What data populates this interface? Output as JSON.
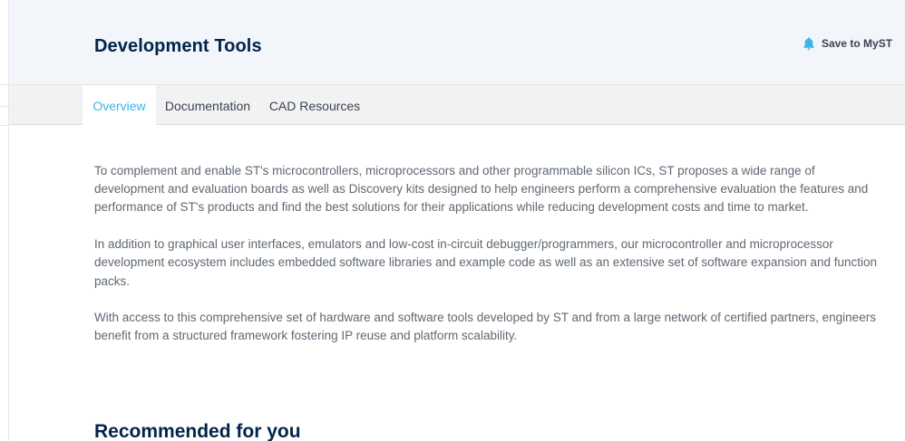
{
  "header": {
    "title": "Development Tools",
    "save_label": "Save to MyST",
    "save_icon": "bell-icon",
    "accent_color": "#3cb4e6"
  },
  "tabs": [
    {
      "label": "Overview",
      "active": true
    },
    {
      "label": "Documentation",
      "active": false
    },
    {
      "label": "CAD Resources",
      "active": false
    }
  ],
  "overview": {
    "paragraphs": [
      "To complement and enable ST's microcontrollers, microprocessors and other programmable silicon ICs, ST proposes a wide range of development and evaluation boards as well as Discovery kits designed to help engineers perform a comprehensive evaluation the features and performance of ST's products and find the best solutions for their applications while reducing development costs and time to market.",
      "In addition to graphical user interfaces, emulators and low-cost in-circuit debugger/programmers, our microcontroller and microprocessor development ecosystem includes embedded software libraries and example code as well as an extensive set of software expansion and function packs.",
      "With access to this comprehensive set of hardware and software tools developed by ST and from a large network of certified partners, engineers benefit from a structured framework fostering IP reuse and platform scalability."
    ]
  },
  "recommended": {
    "heading": "Recommended for you"
  }
}
